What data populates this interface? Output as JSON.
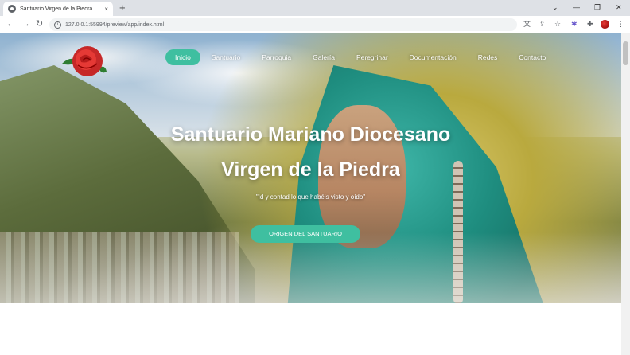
{
  "browser": {
    "tab_title": "Santuario Virgen de la Piedra",
    "tab_close": "×",
    "new_tab": "+",
    "url": "127.0.0.1:55994/preview/app/index.html",
    "window_controls": {
      "menu": "⌄",
      "minimize": "—",
      "maximize": "❐",
      "close": "✕"
    },
    "nav": {
      "back": "←",
      "forward": "→",
      "reload": "↻",
      "info": "i"
    },
    "toolbar_icons": {
      "translate": "文",
      "share": "⇪",
      "bookmark": "☆",
      "extensions_puzzle": "✱",
      "more": "⋮"
    }
  },
  "site": {
    "nav_items": [
      {
        "label": "Inicio",
        "active": true
      },
      {
        "label": "Santuario",
        "active": false
      },
      {
        "label": "Parroquia",
        "active": false
      },
      {
        "label": "Galería",
        "active": false
      },
      {
        "label": "Peregrinar",
        "active": false
      },
      {
        "label": "Documentación",
        "active": false
      },
      {
        "label": "Redes",
        "active": false
      },
      {
        "label": "Contacto",
        "active": false
      }
    ],
    "hero": {
      "title_line1": "Santuario Mariano Diocesano",
      "title_line2": "Virgen de la Piedra",
      "quote": "\"Id y contad lo que habéis visto y oído\"",
      "cta_label": "ORIGEN DEL SANTUARIO"
    },
    "colors": {
      "accent": "#3fbfa0",
      "title": "#ffffff"
    }
  }
}
